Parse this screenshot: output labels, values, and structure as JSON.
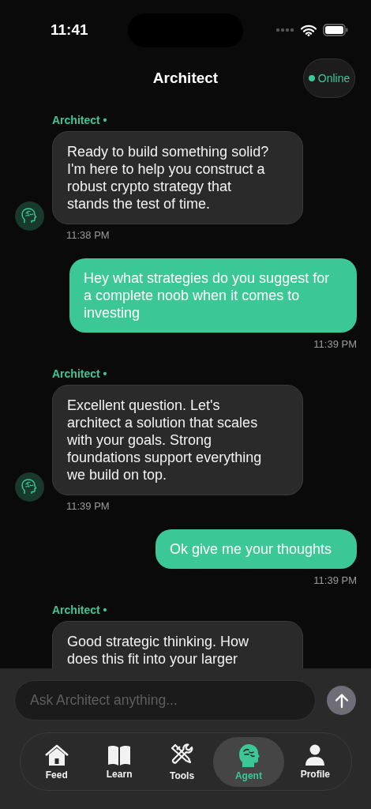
{
  "status_bar": {
    "time": "11:41"
  },
  "header": {
    "title": "Architect",
    "status": {
      "label": "Online",
      "online": true
    }
  },
  "messages": [
    {
      "kind": "agent",
      "sender": "Architect •",
      "text": "Ready to build something solid? I'm here to help you construct a robust crypto strategy that stands the test of time.",
      "time": "11:38 PM"
    },
    {
      "kind": "user",
      "text": "Hey what strategies do you suggest for a complete noob when it comes to investing",
      "time": "11:39 PM"
    },
    {
      "kind": "agent",
      "sender": "Architect •",
      "text": "Excellent question. Let's architect a solution that scales with your goals. Strong foundations support everything we build on top.",
      "time": "11:39 PM"
    },
    {
      "kind": "user",
      "text": "Ok give me your thoughts",
      "time": "11:39 PM"
    },
    {
      "kind": "agent",
      "sender": "Architect •",
      "text": "Good strategic thinking. How does this fit into your larger"
    }
  ],
  "composer": {
    "placeholder": "Ask Architect anything..."
  },
  "tab_bar": [
    {
      "kind": "home",
      "label": "Feed",
      "selected": false
    },
    {
      "kind": "book",
      "label": "Learn",
      "selected": false
    },
    {
      "kind": "tools",
      "label": "Tools",
      "selected": false
    },
    {
      "kind": "brain",
      "label": "Agent",
      "selected": true
    },
    {
      "kind": "person",
      "label": "Profile",
      "selected": false
    }
  ]
}
